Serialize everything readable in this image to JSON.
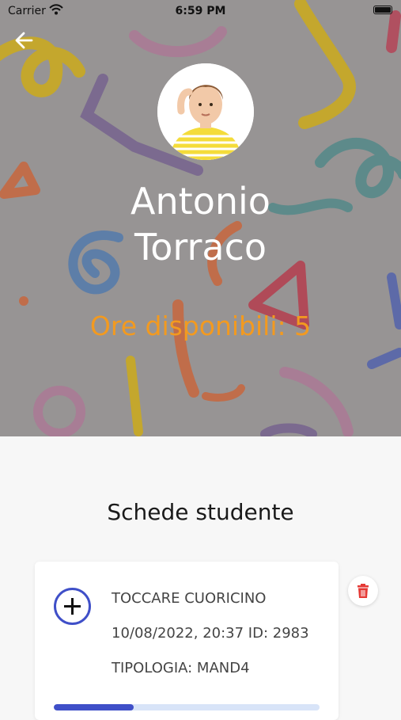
{
  "status_bar": {
    "carrier": "Carrier",
    "time": "6:59 PM"
  },
  "profile": {
    "first_name": "Antonio",
    "last_name": "Torraco",
    "hours_label": "Ore disponibili: 5",
    "hours_color": "#f39a1f"
  },
  "section_title": "Schede studente",
  "cards": [
    {
      "title": "TOCCARE CUORICINO",
      "date_id": "10/08/2022, 20:37 ID: 2983",
      "type": "TIPOLOGIA: MAND4",
      "progress": 0.3
    }
  ],
  "icons": {
    "back": "arrow-left-icon",
    "add": "plus-circle-icon",
    "delete": "trash-icon",
    "wifi": "wifi-icon",
    "battery": "battery-icon"
  },
  "colors": {
    "accent": "#3f4fc8",
    "delete": "#e53935",
    "hero_bg": "#979494"
  }
}
